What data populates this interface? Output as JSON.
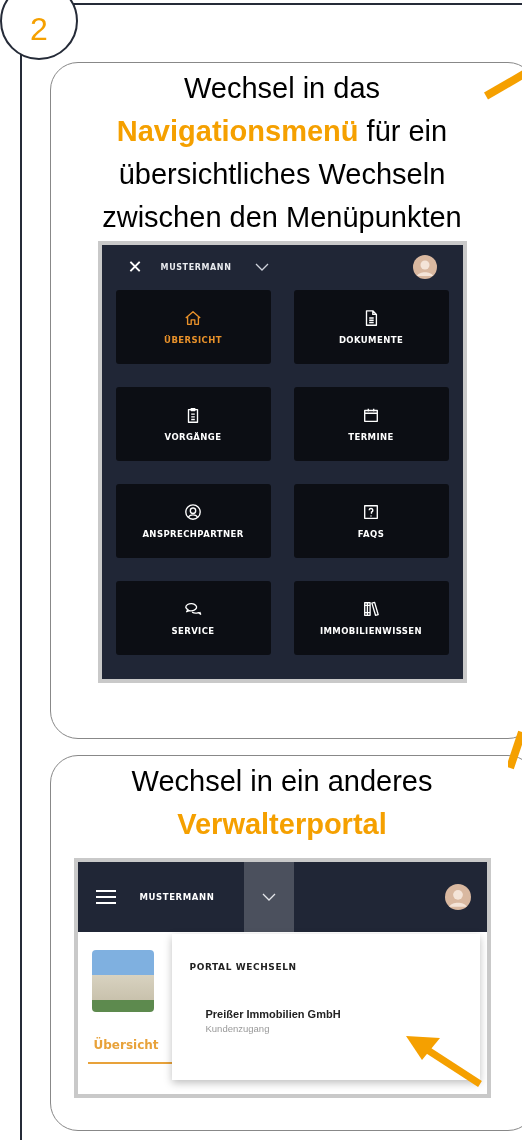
{
  "step": "2",
  "panels": [
    {
      "kind": "menu",
      "caption": [
        "Wechsel in das",
        "**Navigationsmenü** für ein",
        "übersichtliches Wechseln",
        "zwischen den Menüpunkten"
      ],
      "screen": {
        "user": "MUSTERMANN",
        "close": "✕",
        "tiles": [
          {
            "label": "ÜBERSICHT",
            "kind": "house",
            "selected": true
          },
          {
            "label": "DOKUMENTE",
            "kind": "document",
            "selected": false
          },
          {
            "label": "VORGÄNGE",
            "kind": "clipboard",
            "selected": false
          },
          {
            "label": "TERMINE",
            "kind": "calendar",
            "selected": false
          },
          {
            "label": "ANSPRECHPARTNER",
            "kind": "person",
            "selected": false
          },
          {
            "label": "FAQS",
            "kind": "question",
            "selected": false
          },
          {
            "label": "SERVICE",
            "kind": "chat",
            "selected": false
          },
          {
            "label": "IMMOBILIENWISSEN",
            "kind": "books",
            "selected": false
          }
        ]
      }
    },
    {
      "kind": "portal",
      "caption": [
        "Wechsel in ein anderes",
        "**Verwalterportal**"
      ],
      "screen": {
        "user": "MUSTERMANN",
        "dropdown_expanded": true,
        "tab": {
          "label": "Übersicht",
          "selected": true
        },
        "dropdown_title": "PORTAL WECHSELN",
        "portals": [
          {
            "name": "Preißer Immobilien GmbH",
            "role": "Kundenzugang"
          }
        ]
      }
    }
  ]
}
